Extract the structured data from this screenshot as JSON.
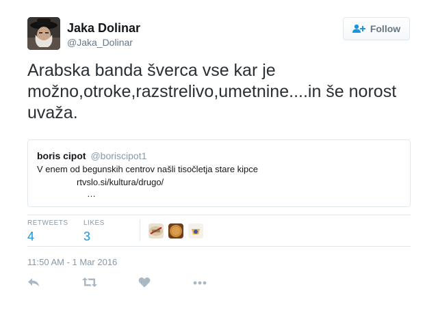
{
  "header": {
    "display_name": "Jaka Dolinar",
    "handle": "@Jaka_Dolinar",
    "follow_label": "Follow",
    "avatar_icon": "user-avatar"
  },
  "tweet": {
    "text": "Arabska banda šverca vse kar je možno,otroke,razstrelivo,umetnine....in še norost uvaža."
  },
  "quote": {
    "name": "boris cipot",
    "handle": "@boriscipot1",
    "line1": "V enem od begunskih centrov našli tisočletja stare kipce",
    "line2": "rtvslo.si/kultura/drugo/",
    "line3": "…"
  },
  "stats": {
    "retweets_label": "RETWEETS",
    "retweets_count": "4",
    "likes_label": "LIKES",
    "likes_count": "3"
  },
  "timestamp": "11:50 AM - 1 Mar 2016",
  "colors": {
    "accent": "#1b95e0",
    "secondary_text": "#8899a6",
    "border": "#e1e8ed"
  },
  "actions": [
    "reply-icon",
    "retweet-icon",
    "like-icon",
    "more-icon"
  ]
}
